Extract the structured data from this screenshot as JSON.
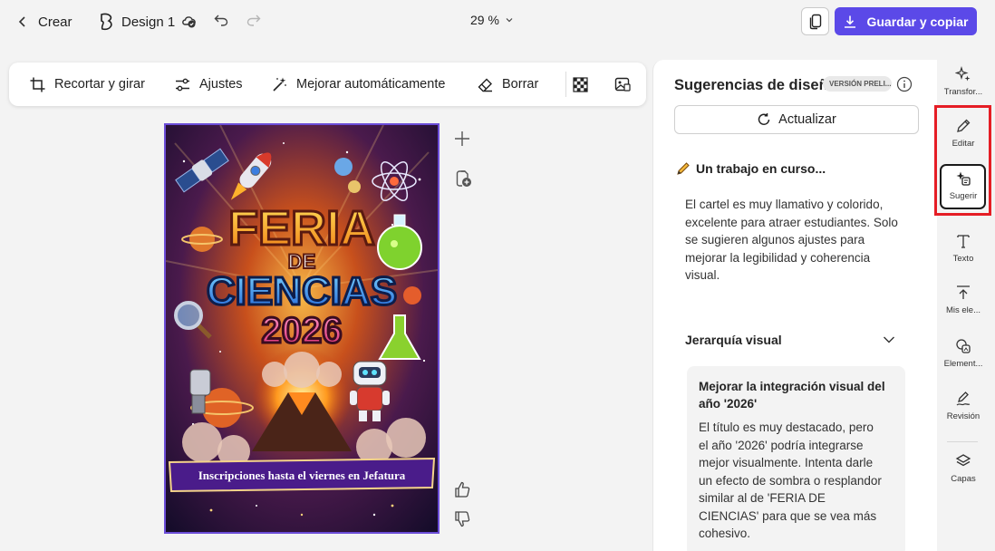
{
  "topbar": {
    "back_label": "Crear",
    "design_name": "Design 1",
    "zoom": "29 %",
    "save_label": "Guardar y copiar",
    "accent": "#5b49e8"
  },
  "toolbar": {
    "items": [
      {
        "label": "Recortar y girar",
        "icon": "crop-rotate-icon"
      },
      {
        "label": "Ajustes",
        "icon": "sliders-icon"
      },
      {
        "label": "Mejorar automáticamente",
        "icon": "magic-wand-icon"
      },
      {
        "label": "Borrar",
        "icon": "eraser-icon"
      }
    ]
  },
  "poster": {
    "title_line1": "FERIA",
    "title_line2": "DE",
    "title_line3": "CIENCIAS",
    "year": "2026",
    "banner": "Inscripciones hasta el viernes en Jefatura"
  },
  "panel": {
    "title": "Sugerencias de diseño",
    "badge": "VERSIÓN PRELI...",
    "update_label": "Actualizar",
    "status": "Un trabajo en curso...",
    "description": "El cartel es muy llamativo y colorido, excelente para atraer estudiantes. Solo se sugieren algunos ajustes para mejorar la legibilidad y coherencia visual.",
    "section": "Jerarquía visual",
    "card": {
      "title": "Mejorar la integración visual del año '2026'",
      "text": "El título es muy destacado, pero el año '2026' podría integrarse mejor visualmente. Intenta darle un efecto de sombra o resplandor similar al de 'FERIA DE CIENCIAS' para que se vea más cohesivo."
    }
  },
  "rail": {
    "items": [
      {
        "label": "Transfor...",
        "icon": "sparkles-icon"
      },
      {
        "label": "Editar",
        "icon": "pencil-icon"
      },
      {
        "label": "Sugerir",
        "icon": "suggest-sparkle-icon",
        "selected": true
      },
      {
        "label": "Texto",
        "icon": "text-icon"
      },
      {
        "label": "Mis ele...",
        "icon": "upload-icon"
      },
      {
        "label": "Element...",
        "icon": "shapes-icon"
      },
      {
        "label": "Revisión",
        "icon": "review-pen-icon"
      },
      {
        "label": "Capas",
        "icon": "layers-icon"
      }
    ]
  }
}
